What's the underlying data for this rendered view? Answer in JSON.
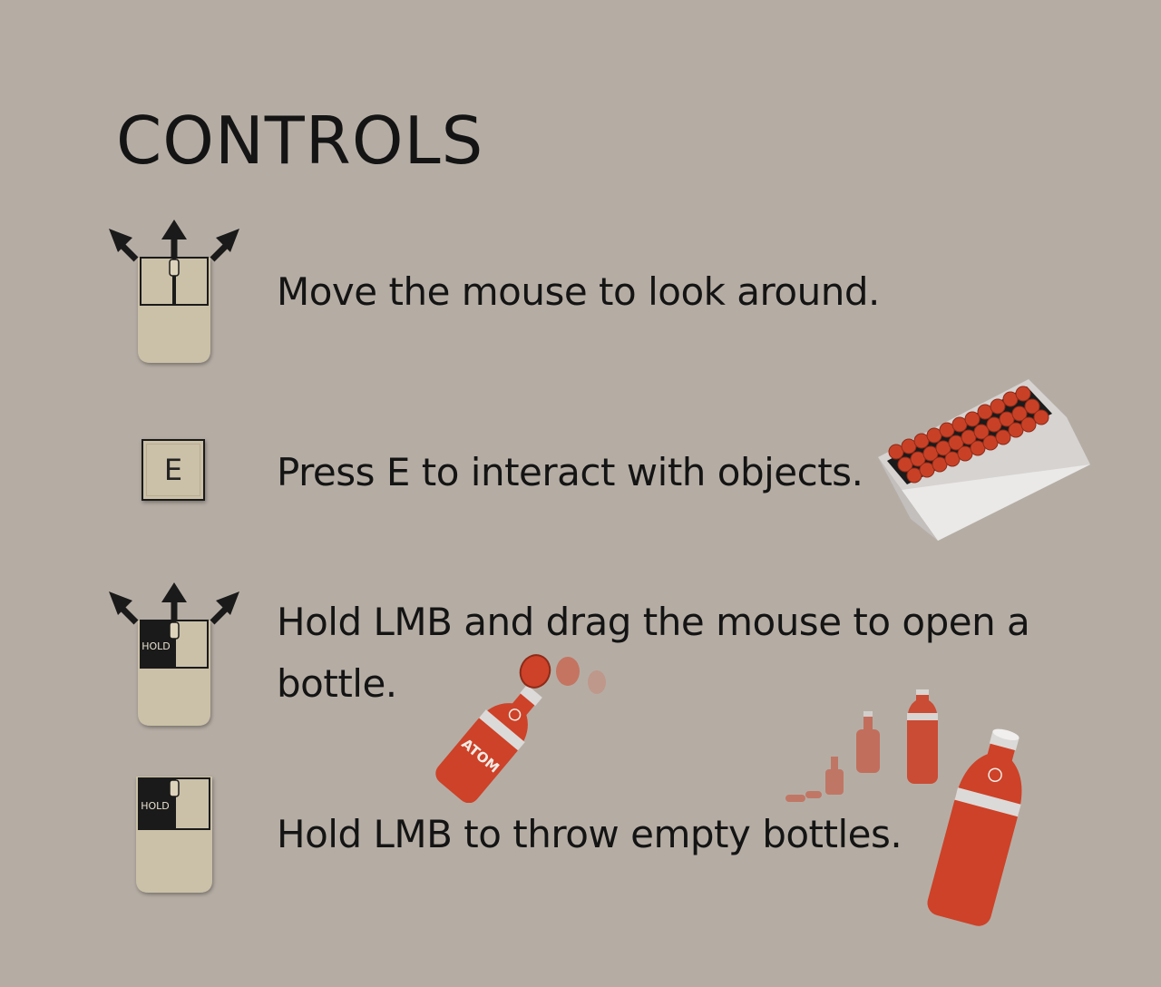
{
  "title": "CONTROLS",
  "rows": [
    {
      "text": "Move the mouse to look around.",
      "icon": "mouse-move-icon"
    },
    {
      "text": "Press E to interact with objects.",
      "icon": "e-key-icon",
      "key": "E"
    },
    {
      "text": "Hold LMB and drag the mouse to open a bottle.",
      "icon": "mouse-hold-drag-icon",
      "hold_label": "HOLD"
    },
    {
      "text": "Hold LMB to throw empty bottles.",
      "icon": "mouse-hold-icon",
      "hold_label": "HOLD"
    }
  ],
  "bottle_brand": "ATOM",
  "colors": {
    "background": "#b5ada4",
    "mouse_body": "#cbc1a8",
    "bottle_red": "#cd4228",
    "crate_white": "#e2e0df"
  }
}
